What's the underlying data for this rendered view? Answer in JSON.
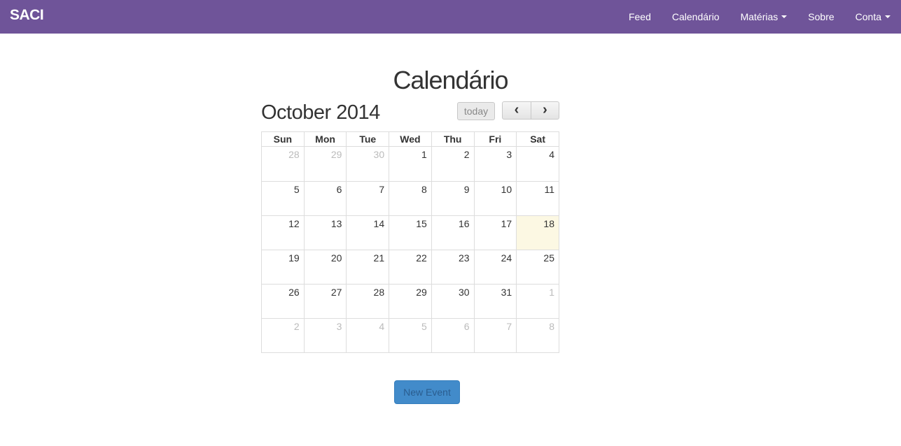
{
  "navbar": {
    "brand": "SACI",
    "items": [
      {
        "label": "Feed",
        "dropdown": false
      },
      {
        "label": "Calendário",
        "dropdown": false
      },
      {
        "label": "Matérias",
        "dropdown": true
      },
      {
        "label": "Sobre",
        "dropdown": false
      },
      {
        "label": "Conta",
        "dropdown": true
      }
    ]
  },
  "page": {
    "title": "Calendário"
  },
  "calendar": {
    "month_title": "October 2014",
    "today_label": "today",
    "prev_label": "‹",
    "next_label": "›",
    "weekdays": [
      "Sun",
      "Mon",
      "Tue",
      "Wed",
      "Thu",
      "Fri",
      "Sat"
    ],
    "weeks": [
      [
        {
          "d": "28",
          "o": true
        },
        {
          "d": "29",
          "o": true
        },
        {
          "d": "30",
          "o": true
        },
        {
          "d": "1"
        },
        {
          "d": "2"
        },
        {
          "d": "3"
        },
        {
          "d": "4"
        }
      ],
      [
        {
          "d": "5"
        },
        {
          "d": "6"
        },
        {
          "d": "7"
        },
        {
          "d": "8"
        },
        {
          "d": "9"
        },
        {
          "d": "10"
        },
        {
          "d": "11"
        }
      ],
      [
        {
          "d": "12"
        },
        {
          "d": "13"
        },
        {
          "d": "14"
        },
        {
          "d": "15"
        },
        {
          "d": "16"
        },
        {
          "d": "17"
        },
        {
          "d": "18",
          "today": true
        }
      ],
      [
        {
          "d": "19"
        },
        {
          "d": "20"
        },
        {
          "d": "21"
        },
        {
          "d": "22"
        },
        {
          "d": "23"
        },
        {
          "d": "24"
        },
        {
          "d": "25"
        }
      ],
      [
        {
          "d": "26"
        },
        {
          "d": "27"
        },
        {
          "d": "28"
        },
        {
          "d": "29"
        },
        {
          "d": "30"
        },
        {
          "d": "31"
        },
        {
          "d": "1",
          "o": true
        }
      ],
      [
        {
          "d": "2",
          "o": true
        },
        {
          "d": "3",
          "o": true
        },
        {
          "d": "4",
          "o": true
        },
        {
          "d": "5",
          "o": true
        },
        {
          "d": "6",
          "o": true
        },
        {
          "d": "7",
          "o": true
        },
        {
          "d": "8",
          "o": true
        }
      ]
    ]
  },
  "actions": {
    "new_event_label": "New Event"
  },
  "colors": {
    "navbar": "#6f5499",
    "today_highlight": "#fcf8e3",
    "primary_button": "#428bca"
  }
}
